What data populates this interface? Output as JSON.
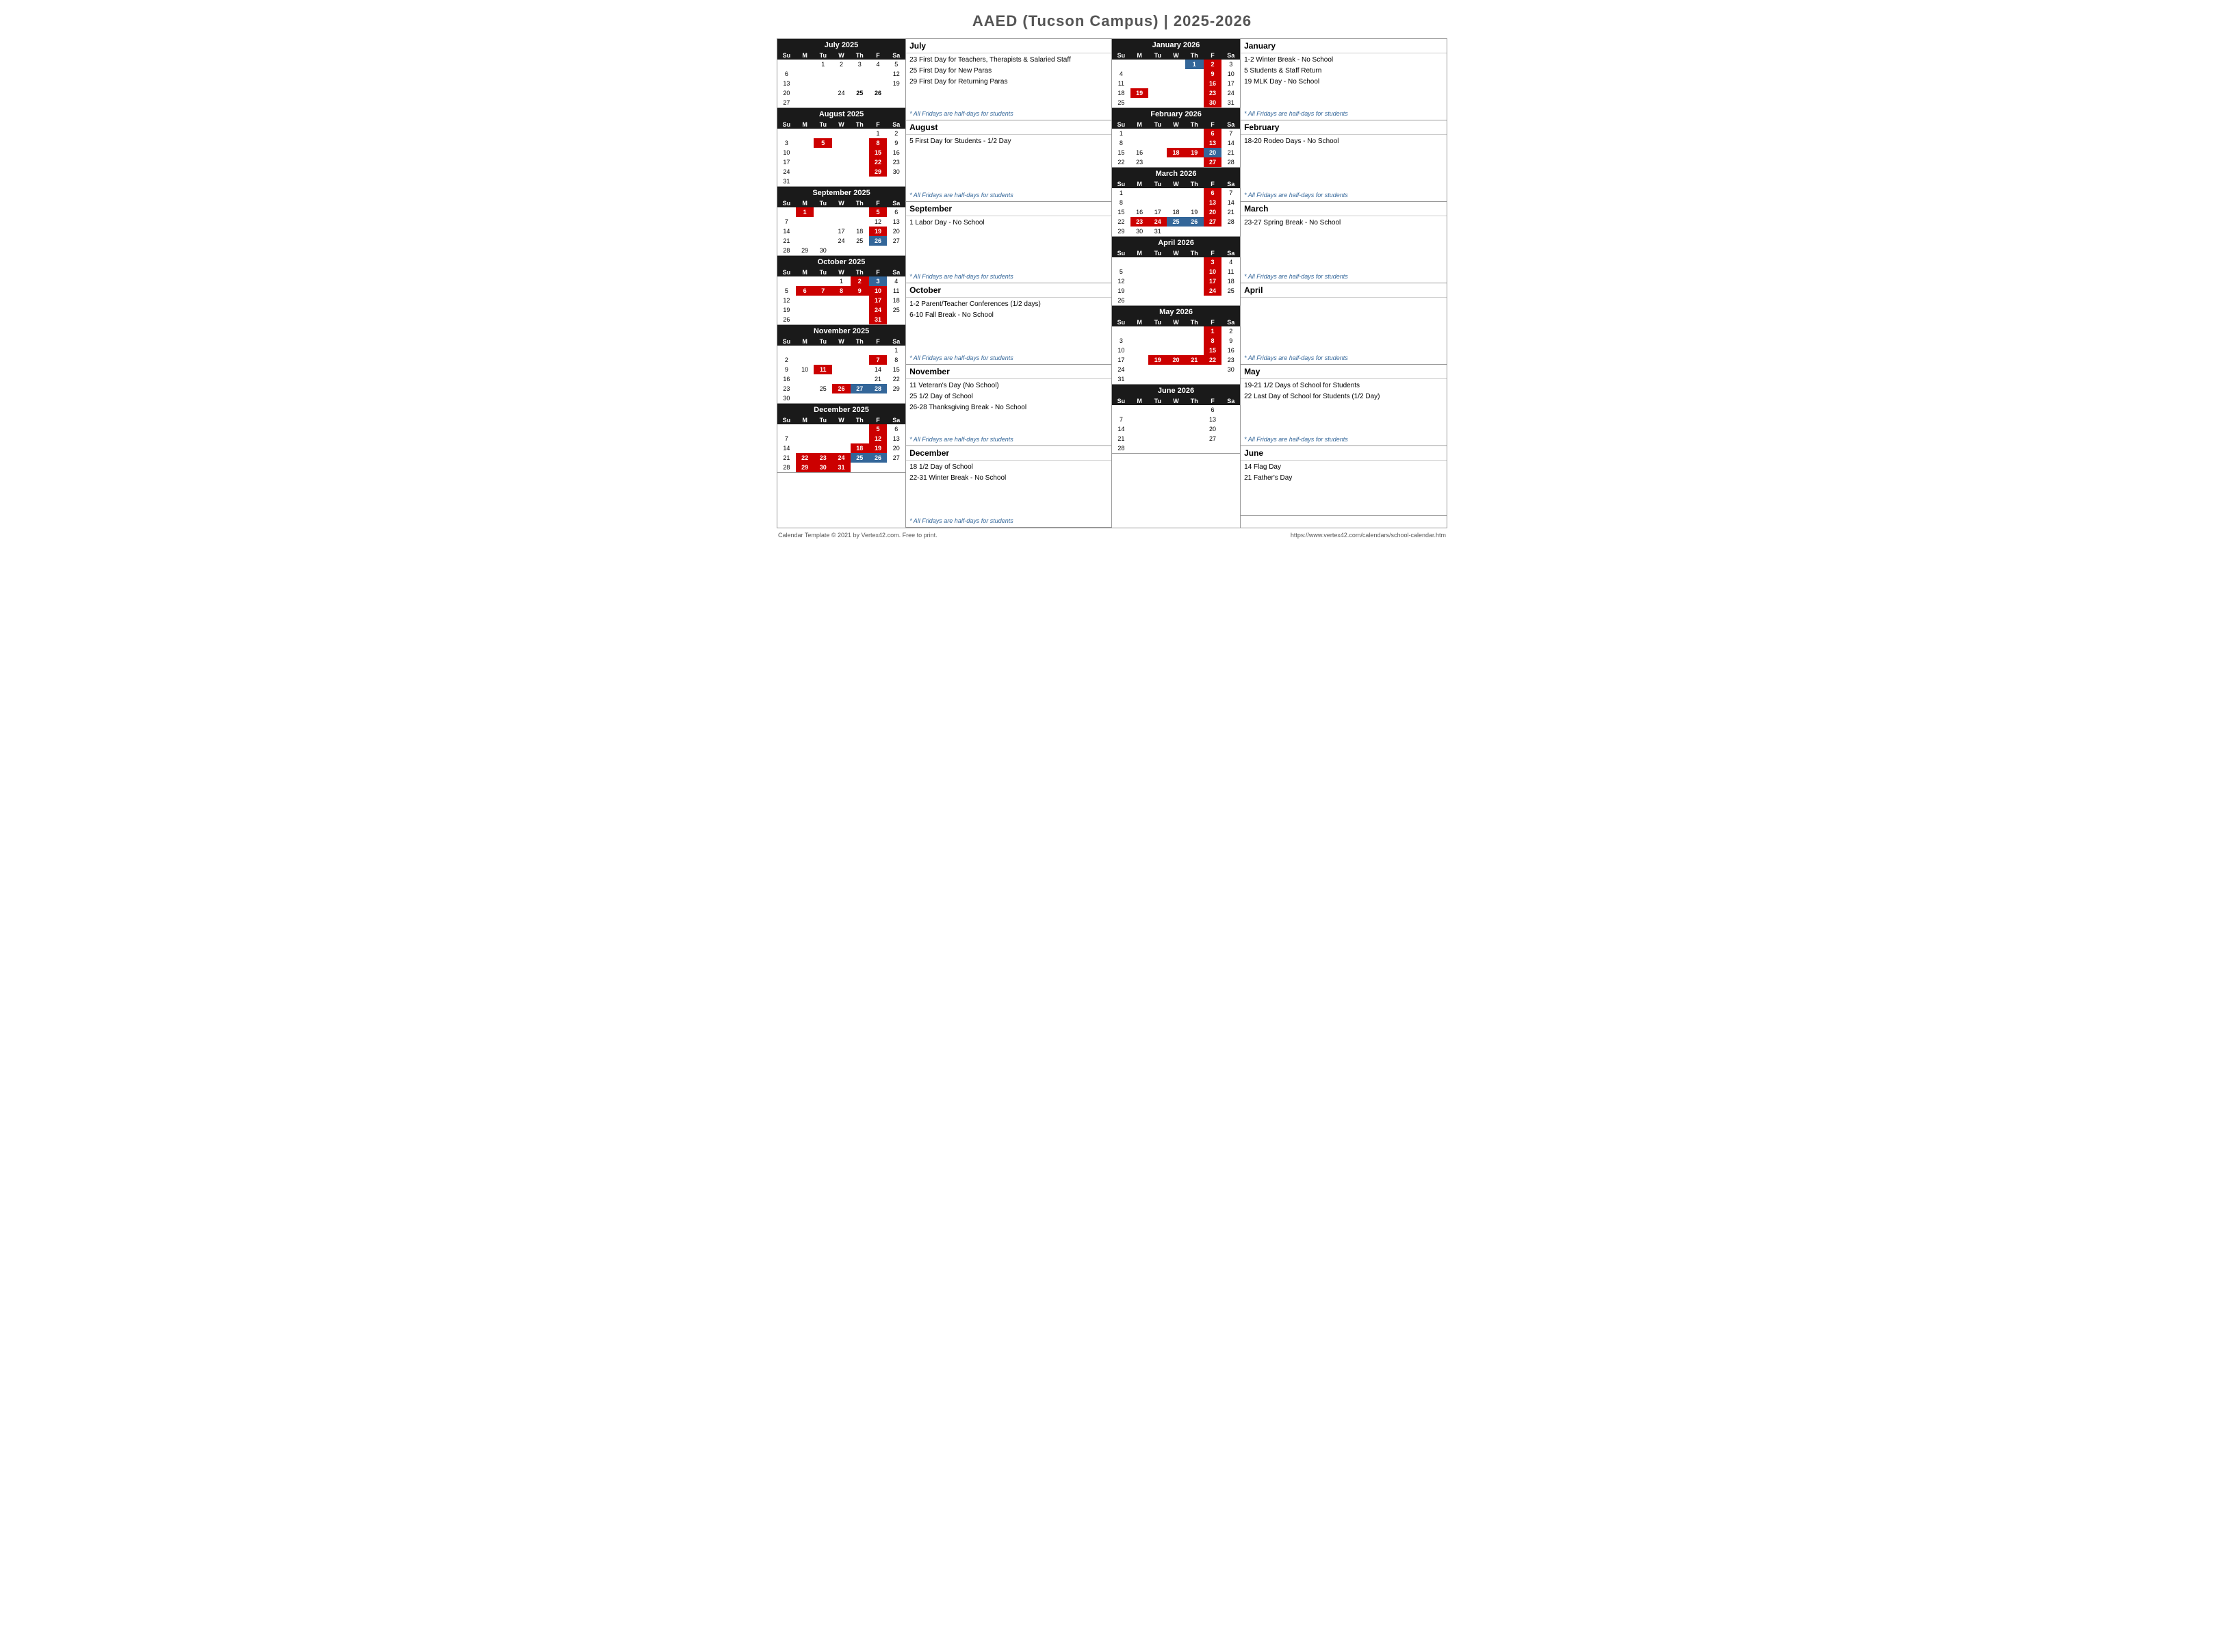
{
  "title": "AAED (Tucson Campus) | 2025-2026",
  "footer": {
    "left": "Calendar Template © 2021 by Vertex42.com. Free to print.",
    "right": "https://www.vertex42.com/calendars/school-calendar.htm"
  },
  "dow": [
    "Su",
    "M",
    "Tu",
    "W",
    "Th",
    "F",
    "Sa"
  ],
  "months": [
    {
      "name": "July 2025",
      "rows": [
        [
          "",
          "",
          "1",
          "2",
          "3",
          "4",
          "5"
        ],
        [
          "6",
          "",
          "",
          "",
          "",
          "",
          "12"
        ],
        [
          "13",
          "",
          "",
          "",
          "",
          "",
          "19"
        ],
        [
          "20",
          "",
          "",
          "24",
          "25",
          "26",
          ""
        ],
        [
          "27",
          "",
          "",
          "",
          "",
          "",
          ""
        ]
      ],
      "highlights": {
        "r1c6": "plain",
        "r2c1": "plain",
        "r2c7": "plain",
        "r3c1": "plain",
        "r3c7": "plain",
        "r4c1": "plain",
        "r4c5": "bold-black",
        "r4c6": "bold-black"
      }
    },
    {
      "name": "August 2025",
      "rows": [
        [
          "",
          "",
          "",
          "",
          "",
          "1",
          "2"
        ],
        [
          "3",
          "",
          "5",
          "",
          "",
          "8",
          "9"
        ],
        [
          "10",
          "",
          "",
          "",
          "",
          "15",
          "16"
        ],
        [
          "17",
          "",
          "",
          "",
          "",
          "22",
          "23"
        ],
        [
          "24",
          "",
          "",
          "",
          "",
          "29",
          "30"
        ],
        [
          "31",
          "",
          "",
          "",
          "",
          "",
          ""
        ]
      ],
      "highlights": {
        "r1c6": "plain",
        "r2c3": "highlight-red",
        "r2c6": "highlight-red",
        "r3c6": "highlight-red",
        "r4c6": "highlight-red",
        "r5c6": "highlight-red"
      }
    },
    {
      "name": "September 2025",
      "rows": [
        [
          "",
          "1",
          "",
          "",
          "",
          "5",
          "6"
        ],
        [
          "7",
          "",
          "",
          "",
          "",
          "12",
          "13"
        ],
        [
          "14",
          "",
          "",
          "17",
          "18",
          "19",
          "20"
        ],
        [
          "21",
          "",
          "",
          "24",
          "25",
          "26",
          "27"
        ],
        [
          "28",
          "29",
          "30",
          "",
          "",
          "",
          ""
        ]
      ],
      "highlights": {
        "r1c2": "highlight-red",
        "r1c6": "highlight-red",
        "r3c6": "highlight-red",
        "r4c6": "highlight-blue"
      }
    },
    {
      "name": "October 2025",
      "rows": [
        [
          "",
          "",
          "",
          "1",
          "2",
          "3",
          "4"
        ],
        [
          "5",
          "6",
          "7",
          "8",
          "9",
          "10",
          "11"
        ],
        [
          "12",
          "",
          "",
          "",
          "",
          "17",
          "18"
        ],
        [
          "19",
          "",
          "",
          "",
          "",
          "24",
          "25"
        ],
        [
          "26",
          "",
          "",
          "",
          "",
          "31",
          ""
        ]
      ],
      "highlights": {
        "r1c4": "plain",
        "r1c5": "highlight-red",
        "r1c6": "highlight-blue",
        "r2c2": "highlight-red",
        "r2c3": "highlight-red",
        "r2c4": "highlight-red",
        "r2c5": "highlight-red",
        "r2c6": "highlight-red",
        "r3c6": "highlight-red",
        "r4c6": "highlight-red",
        "r5c6": "highlight-red"
      }
    },
    {
      "name": "November 2025",
      "rows": [
        [
          "",
          "",
          "",
          "",
          "",
          "",
          "1"
        ],
        [
          "2",
          "",
          "",
          "",
          "",
          "7",
          "8"
        ],
        [
          "9",
          "10",
          "11",
          "",
          "",
          "14",
          "15"
        ],
        [
          "16",
          "",
          "",
          "",
          "",
          "21",
          "22"
        ],
        [
          "23",
          "",
          "25",
          "26",
          "27",
          "28",
          "29"
        ],
        [
          "30",
          "",
          "",
          "",
          "",
          "",
          ""
        ]
      ],
      "highlights": {
        "r1c7": "plain",
        "r2c6": "highlight-red",
        "r3c2": "plain",
        "r3c3": "highlight-red",
        "r3c6": "plain",
        "r4c6": "plain",
        "r5c3": "plain",
        "r5c4": "highlight-red",
        "r5c5": "highlight-blue",
        "r5c6": "highlight-blue",
        "r5c7": "plain"
      }
    },
    {
      "name": "December 2025",
      "rows": [
        [
          "",
          "",
          "",
          "",
          "",
          "5",
          "6"
        ],
        [
          "7",
          "",
          "",
          "",
          "",
          "12",
          "13"
        ],
        [
          "14",
          "",
          "",
          "",
          "18",
          "19",
          "20"
        ],
        [
          "21",
          "22",
          "23",
          "24",
          "25",
          "26",
          "27"
        ],
        [
          "28",
          "29",
          "30",
          "31",
          "",
          "",
          ""
        ]
      ],
      "highlights": {
        "r1c6": "highlight-red",
        "r2c6": "highlight-red",
        "r3c5": "highlight-red",
        "r3c6": "highlight-red",
        "r4c2": "highlight-red",
        "r4c3": "highlight-red",
        "r4c4": "highlight-red",
        "r4c5": "highlight-blue",
        "r4c6": "highlight-blue",
        "r5c2": "highlight-red",
        "r5c3": "highlight-red",
        "r5c4": "highlight-red"
      }
    }
  ],
  "months_right": [
    {
      "name": "January 2026",
      "rows": [
        [
          "",
          "",
          "",
          "",
          "1",
          "2",
          "3"
        ],
        [
          "4",
          "",
          "",
          "",
          "",
          "9",
          "10"
        ],
        [
          "11",
          "",
          "",
          "",
          "",
          "16",
          "17"
        ],
        [
          "18",
          "19",
          "",
          "",
          "",
          "23",
          "24"
        ],
        [
          "25",
          "",
          "",
          "",
          "",
          "30",
          "31"
        ]
      ],
      "highlights": {
        "r1c5": "highlight-blue",
        "r1c6": "highlight-red",
        "r2c6": "highlight-red",
        "r3c6": "highlight-red",
        "r4c2": "highlight-red",
        "r4c6": "highlight-red",
        "r5c6": "highlight-red"
      }
    },
    {
      "name": "February 2026",
      "rows": [
        [
          "1",
          "",
          "",
          "",
          "",
          "6",
          "7"
        ],
        [
          "8",
          "",
          "",
          "",
          "",
          "13",
          "14"
        ],
        [
          "15",
          "16",
          "",
          "18",
          "19",
          "20",
          "21"
        ],
        [
          "22",
          "23",
          "",
          "",
          "",
          "27",
          "28"
        ]
      ],
      "highlights": {
        "r1c6": "highlight-red",
        "r2c6": "highlight-red",
        "r3c3": "plain",
        "r3c4": "highlight-red",
        "r3c5": "highlight-red",
        "r3c6": "highlight-blue",
        "r4c6": "highlight-red"
      }
    },
    {
      "name": "March 2026",
      "rows": [
        [
          "1",
          "",
          "",
          "",
          "",
          "6",
          "7"
        ],
        [
          "8",
          "",
          "",
          "",
          "",
          "13",
          "14"
        ],
        [
          "15",
          "16",
          "17",
          "18",
          "19",
          "20",
          "21"
        ],
        [
          "22",
          "23",
          "24",
          "25",
          "26",
          "27",
          "28"
        ],
        [
          "29",
          "30",
          "31",
          "",
          "",
          "",
          ""
        ]
      ],
      "highlights": {
        "r1c6": "highlight-red",
        "r2c6": "highlight-red",
        "r3c6": "highlight-red",
        "r4c2": "highlight-red",
        "r4c3": "highlight-red",
        "r4c4": "highlight-blue",
        "r4c5": "highlight-blue",
        "r4c6": "highlight-red"
      }
    },
    {
      "name": "April 2026",
      "rows": [
        [
          "",
          "",
          "",
          "",
          "",
          "3",
          "4"
        ],
        [
          "5",
          "",
          "",
          "",
          "",
          "10",
          "11"
        ],
        [
          "12",
          "",
          "",
          "",
          "",
          "17",
          "18"
        ],
        [
          "19",
          "",
          "",
          "",
          "",
          "24",
          "25"
        ],
        [
          "26",
          "",
          "",
          "",
          "",
          "",
          ""
        ]
      ],
      "highlights": {
        "r1c6": "highlight-red",
        "r2c6": "highlight-red",
        "r3c6": "highlight-red",
        "r4c6": "highlight-red"
      }
    },
    {
      "name": "May 2026",
      "rows": [
        [
          "",
          "",
          "",
          "",
          "",
          "1",
          "2"
        ],
        [
          "3",
          "",
          "",
          "",
          "",
          "8",
          "9"
        ],
        [
          "10",
          "",
          "",
          "",
          "",
          "15",
          "16"
        ],
        [
          "17",
          "",
          "19",
          "20",
          "21",
          "22",
          "23"
        ],
        [
          "24",
          "",
          "",
          "",
          "",
          "",
          "30"
        ],
        [
          "31",
          "",
          "",
          "",
          "",
          "",
          ""
        ]
      ],
      "highlights": {
        "r1c6": "highlight-red",
        "r2c6": "highlight-red",
        "r3c6": "highlight-red",
        "r4c3": "highlight-red",
        "r4c4": "highlight-red",
        "r4c5": "highlight-red",
        "r4c6": "highlight-red",
        "r5c7": "plain"
      }
    },
    {
      "name": "June 2026",
      "rows": [
        [
          "",
          "",
          "",
          "",
          "",
          "6",
          ""
        ],
        [
          "7",
          "",
          "",
          "",
          "",
          "13",
          ""
        ],
        [
          "14",
          "",
          "",
          "",
          "",
          "20",
          ""
        ],
        [
          "21",
          "",
          "",
          "",
          "",
          "27",
          ""
        ],
        [
          "28",
          "",
          "",
          "",
          "",
          "",
          ""
        ]
      ],
      "highlights": {}
    }
  ],
  "notes_left": [
    {
      "header": "July",
      "items": [
        "23    First Day for Teachers, Therapists & Salaried Staff",
        "25    First Day for New Paras",
        "29    First Day for Returning Paras"
      ],
      "italic": "* All Fridays are half-days for students"
    },
    {
      "header": "August",
      "items": [
        "5    First Day for Students - 1/2 Day"
      ],
      "italic": "* All Fridays are half-days for students"
    },
    {
      "header": "September",
      "items": [
        "1    Labor Day - No School"
      ],
      "italic": "* All Fridays are half-days for students"
    },
    {
      "header": "October",
      "items": [
        "1-2    Parent/Teacher Conferences (1/2 days)",
        "6-10   Fall Break - No School"
      ],
      "italic": "* All Fridays are half-days for students"
    },
    {
      "header": "November",
      "items": [
        "11    Veteran's Day (No School)",
        "25    1/2 Day of School",
        "26-28  Thanksgiving Break - No School"
      ],
      "italic": "* All Fridays are half-days for students"
    },
    {
      "header": "December",
      "items": [
        "18    1/2 Day of School",
        "22-31  Winter Break - No School"
      ],
      "italic": "* All Fridays are half-days for students"
    }
  ],
  "notes_right": [
    {
      "header": "January",
      "items": [
        "1-2    Winter Break - No School",
        "5      Students & Staff  Return",
        "19     MLK Day - No School"
      ],
      "italic": "* All Fridays are half-days for students"
    },
    {
      "header": "February",
      "items": [
        "18-20  Rodeo Days - No School"
      ],
      "italic": "* All Fridays are half-days for students"
    },
    {
      "header": "March",
      "items": [
        "23-27  Spring Break - No School"
      ],
      "italic": "* All Fridays are half-days for students"
    },
    {
      "header": "April",
      "items": [],
      "italic": "* All Fridays are half-days for students"
    },
    {
      "header": "May",
      "items": [
        "19-21  1/2 Days of School for Students",
        "22     Last Day of School for Students (1/2 Day)"
      ],
      "italic": "* All Fridays are half-days for students"
    },
    {
      "header": "June",
      "items": [
        "14     Flag Day",
        "21     Father's Day"
      ],
      "italic": ""
    }
  ]
}
